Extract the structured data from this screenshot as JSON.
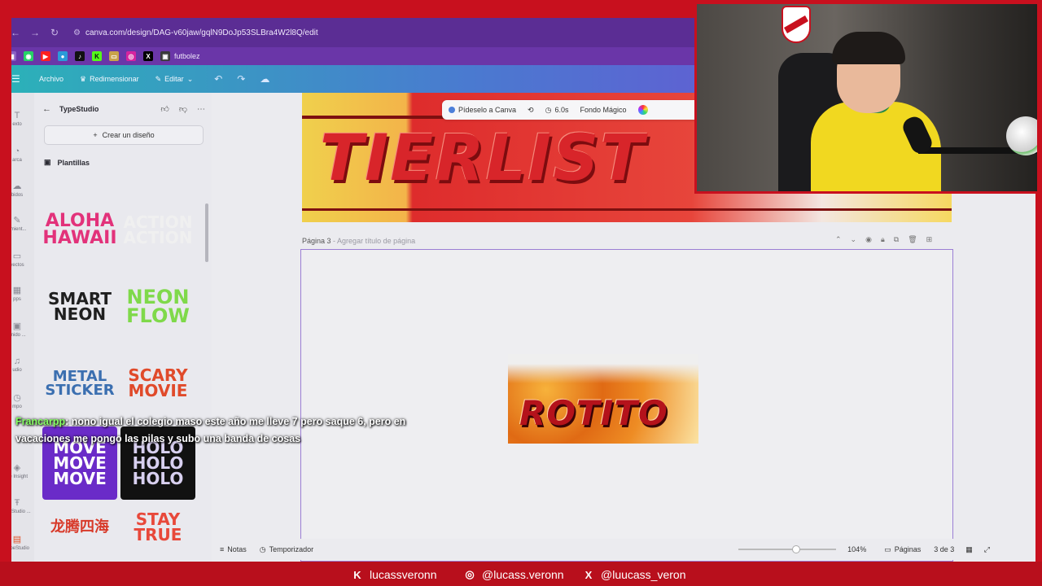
{
  "browser": {
    "url": "canva.com/design/DAG-v60jaw/gqlN9DoJp53SLBra4W2l8Q/edit",
    "bookmark_label": "futbolez"
  },
  "canva_header": {
    "archivo": "Archivo",
    "redimensionar": "Redimensionar",
    "editar": "Editar"
  },
  "rail": {
    "items": [
      "exto",
      "arca",
      "bidos",
      "amient...",
      "yectos",
      "pps",
      "enido ...",
      "udio",
      "mpo",
      "ge Insight",
      "ext Studio ...",
      "TypeStudio"
    ]
  },
  "panel": {
    "title": "TypeStudio",
    "create_button": "Crear un diseño",
    "section_title": "Plantillas",
    "templates": [
      {
        "text": "ALOHA HAWAII",
        "color": "#e2327a",
        "bg": "#e9e9ee"
      },
      {
        "text": "ACTION ACTION",
        "color": "#f0f0f0",
        "bg": "#e9e9ee"
      },
      {
        "text": "SMART NEON",
        "color": "#1f1f1f",
        "bg": "#e9e9ee"
      },
      {
        "text": "NEON FLOW",
        "color": "#7fd94a",
        "bg": "#e9e9ee"
      },
      {
        "text": "METAL STICKER",
        "color": "#3b6fb0",
        "bg": "#e9e9ee"
      },
      {
        "text": "SCARY MOVIE",
        "color": "#e04a2a",
        "bg": "#e9e9ee"
      },
      {
        "text": "MOVE MOVE MOVE",
        "color": "#ffffff",
        "bg": "#6a2bc8"
      },
      {
        "text": "HOLO HOLO HOLO",
        "color": "#d8d0f0",
        "bg": "#111111"
      },
      {
        "text": "龙腾四海",
        "color": "#d83a2a",
        "bg": "#e9e9ee"
      },
      {
        "text": "STAY TRUE",
        "color": "#e8483a",
        "bg": "#e9e9ee"
      }
    ]
  },
  "editor": {
    "page2_title": "TIERLIST",
    "toolbar": {
      "pideselo": "Pídeselo a Canva",
      "duration": "6.0s",
      "fondo": "Fondo Mágico"
    },
    "page3_label": "Página 3",
    "page3_placeholder": "- Agregar título de página",
    "rotito": "ROTITO"
  },
  "bottombar": {
    "notas": "Notas",
    "temporizador": "Temporizador",
    "zoom": "104%",
    "paginas": "Páginas",
    "page_count": "3 de 3"
  },
  "chat": {
    "user": "Francarpp",
    "message": ": nono igual el colegio maso este año me lleve 7 pero saque 6, pero en vacaciones me pongo las pilas y subo una banda de cosas"
  },
  "social": {
    "kick": "lucassveronn",
    "instagram": "@lucass.veronn",
    "x": "@luucass_veron"
  },
  "colors": {
    "frame_red": "#c8101e",
    "canva_purple": "#5b2d94",
    "chat_user_green": "#86ff63"
  }
}
